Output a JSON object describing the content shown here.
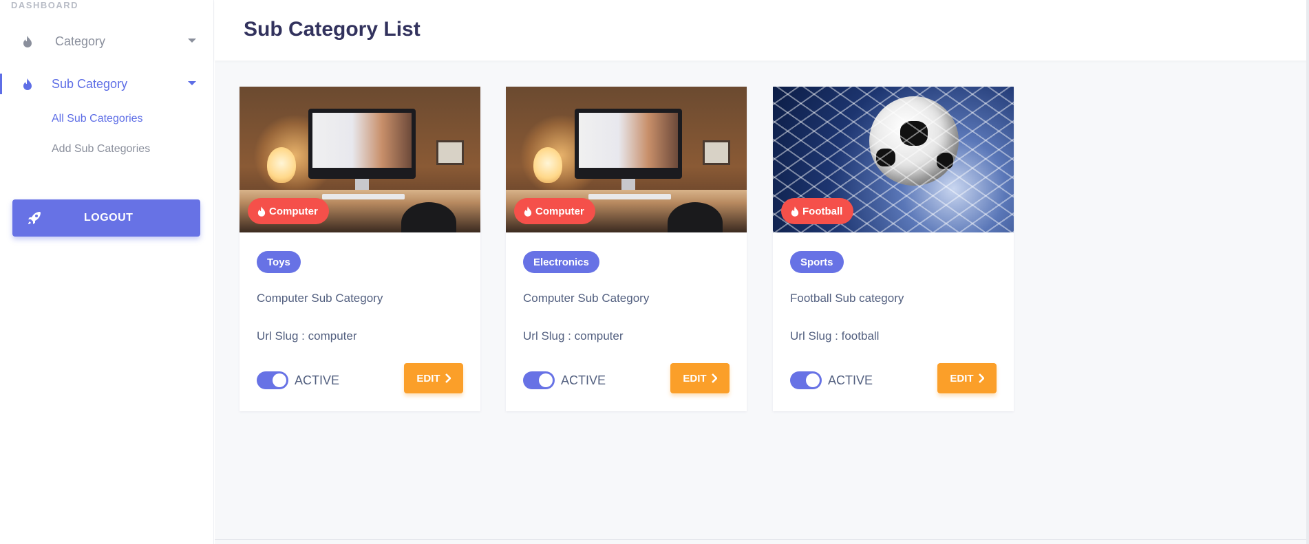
{
  "sidebar": {
    "heading": "DASHBOARD",
    "category_label": "Category",
    "subcategory_label": "Sub Category",
    "sub_links": {
      "all": "All Sub Categories",
      "add": "Add Sub Categories"
    },
    "logout_label": "LOGOUT"
  },
  "header": {
    "title": "Sub Category List"
  },
  "cards": [
    {
      "image_badge": "Computer",
      "category_pill": "Toys",
      "title": "Computer Sub Category",
      "slug": "Url Slug : computer",
      "status_label": "ACTIVE",
      "edit_label": "EDIT",
      "image_icon": "desk-computer-photo"
    },
    {
      "image_badge": "Computer",
      "category_pill": "Electronics",
      "title": "Computer Sub Category",
      "slug": "Url Slug : computer",
      "status_label": "ACTIVE",
      "edit_label": "EDIT",
      "image_icon": "desk-computer-photo"
    },
    {
      "image_badge": "Football",
      "category_pill": "Sports",
      "title": "Football Sub category",
      "slug": "Url Slug : football",
      "status_label": "ACTIVE",
      "edit_label": "EDIT",
      "image_icon": "football-net-photo"
    }
  ],
  "colors": {
    "primary": "#6772e5",
    "danger": "#f5504a",
    "warning": "#fb9f29",
    "title": "#32325d"
  }
}
